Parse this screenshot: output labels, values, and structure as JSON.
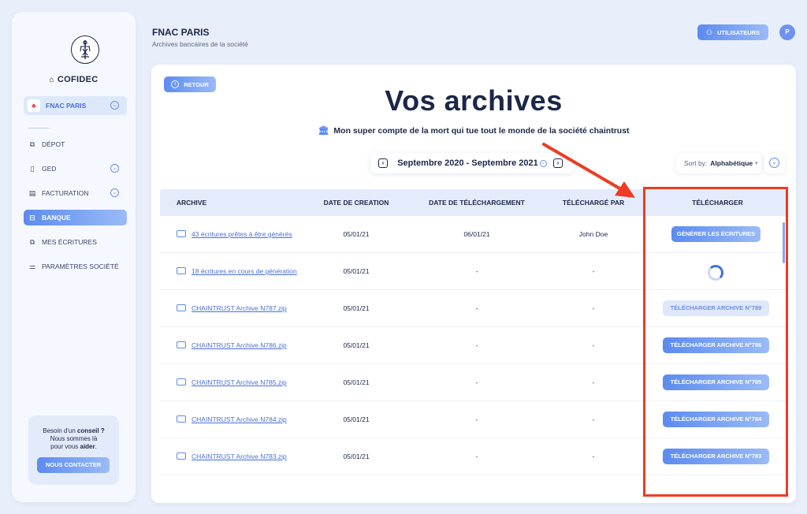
{
  "sidebar": {
    "brand": "COFIDEC",
    "company": "FNAC PARIS",
    "items": [
      {
        "label": "DÉPOT",
        "icon": "deposit-icon"
      },
      {
        "label": "GED",
        "icon": "document-icon"
      },
      {
        "label": "FACTURATION",
        "icon": "invoice-icon"
      },
      {
        "label": "BANQUE",
        "icon": "bank-icon"
      },
      {
        "label": "MES ÉCRITURES",
        "icon": "entries-icon"
      },
      {
        "label": "PARAMÈTRES SOCIÉTÉ",
        "icon": "settings-icon"
      }
    ],
    "help": {
      "line1_pre": "Besoin d'un ",
      "line1_bold": "conseil",
      "line1_post": " ?",
      "line2": "Nous sommes là",
      "line3_pre": "pour vous ",
      "line3_bold": "aider",
      "line3_post": ".",
      "button": "NOUS CONTACTER"
    }
  },
  "header": {
    "title": "FNAC PARIS",
    "subtitle": "Archives bancaires de la société",
    "users_button": "UTILISATEURS",
    "avatar": "P"
  },
  "main": {
    "back_button": "RETOUR",
    "title": "Vos archives",
    "subtitle": "Mon super compte de la mort qui tue tout le monde de la société chaintrust",
    "period": "Septembre 2020 - Septembre 2021",
    "sort_label": "Sort by:",
    "sort_value": "Alphabétique",
    "columns": [
      "ARCHIVE",
      "DATE DE CREATION",
      "DATE DE TÉLÉCHARGEMENT",
      "TÉLÉCHARGÉ PAR",
      "TÉLÉCHARGER"
    ],
    "rows": [
      {
        "archive": "43 écritures prêtes à être générés",
        "created": "05/01/21",
        "downloaded": "06/01/21",
        "by": "John Doe",
        "action": "GÉNÉRER LES ÉCRITURES",
        "state": "active"
      },
      {
        "archive": "18 écritures en cours de génération",
        "created": "05/01/21",
        "downloaded": "-",
        "by": "-",
        "action": "",
        "state": "loading"
      },
      {
        "archive": "CHAINTRUST Archive N787.zip",
        "created": "05/01/21",
        "downloaded": "-",
        "by": "-",
        "action": "TÉLÉCHARGER ARCHIVE N°789",
        "state": "disabled"
      },
      {
        "archive": "CHAINTRUST Archive N786.zip",
        "created": "05/01/21",
        "downloaded": "-",
        "by": "-",
        "action": "TÉLÉCHARGER ARCHIVE N°786",
        "state": "active"
      },
      {
        "archive": "CHAINTRUST Archive N785.zip",
        "created": "05/01/21",
        "downloaded": "-",
        "by": "-",
        "action": "TÉLÉCHARGER ARCHIVE N°785",
        "state": "active"
      },
      {
        "archive": "CHAINTRUST Archive N784.zip",
        "created": "05/01/21",
        "downloaded": "-",
        "by": "-",
        "action": "TÉLÉCHARGER ARCHIVE N°784",
        "state": "active"
      },
      {
        "archive": "CHAINTRUST Archive N783.zip",
        "created": "05/01/21",
        "downloaded": "-",
        "by": "-",
        "action": "TÉLÉCHARGER ARCHIVE N°783",
        "state": "active"
      }
    ]
  },
  "colors": {
    "accent": "#5c8bf0",
    "dark": "#1c2748",
    "annotation": "#ee3b24"
  }
}
